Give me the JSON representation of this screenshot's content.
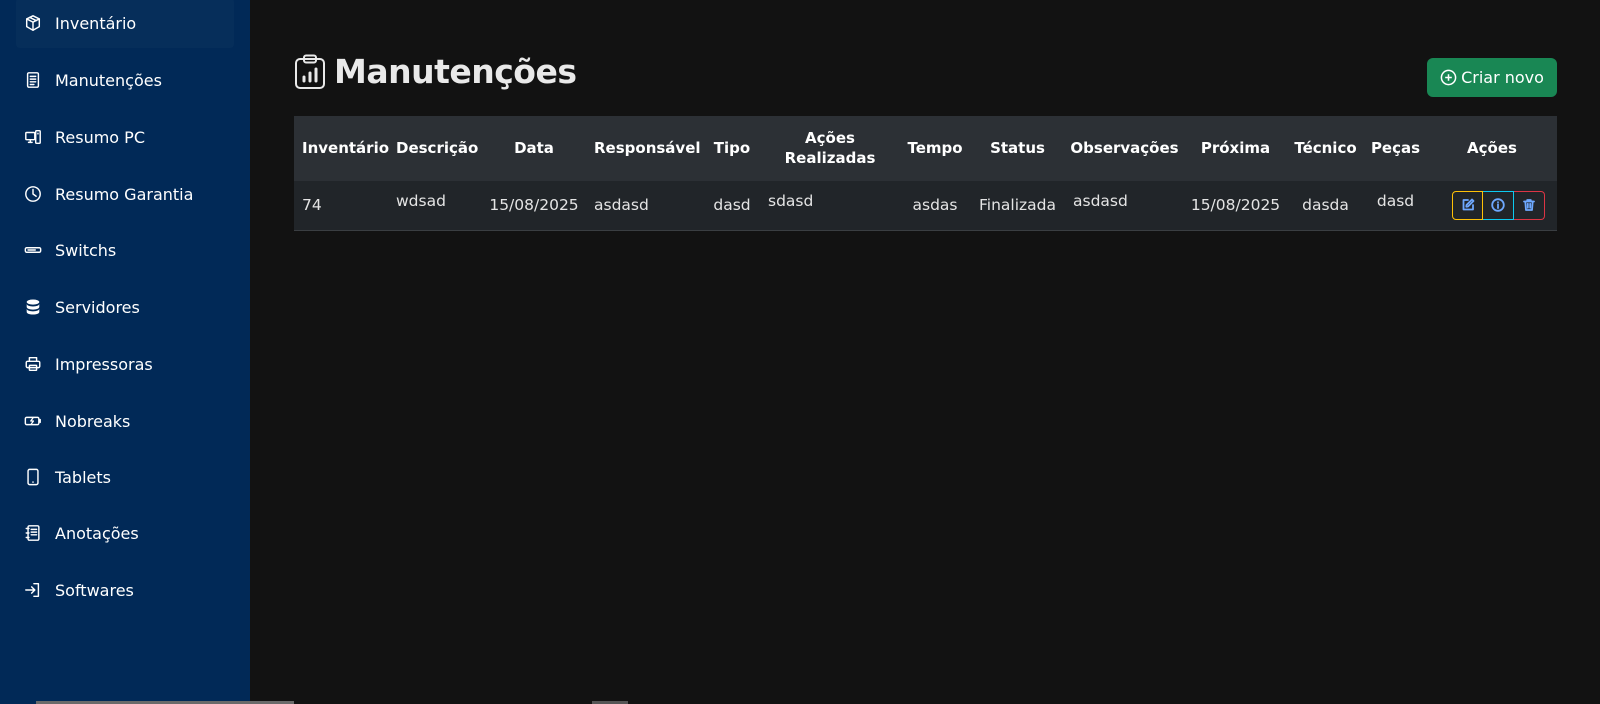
{
  "sidebar": {
    "items": [
      {
        "label": "Inventário",
        "icon": "box-icon",
        "active": true
      },
      {
        "label": "Manutenções",
        "icon": "document-icon"
      },
      {
        "label": "Resumo PC",
        "icon": "pc-icon"
      },
      {
        "label": "Resumo Garantia",
        "icon": "clock-icon"
      },
      {
        "label": "Switchs",
        "icon": "switch-icon"
      },
      {
        "label": "Servidores",
        "icon": "database-icon"
      },
      {
        "label": "Impressoras",
        "icon": "printer-icon"
      },
      {
        "label": "Nobreaks",
        "icon": "battery-icon"
      },
      {
        "label": "Tablets",
        "icon": "tablet-icon"
      },
      {
        "label": "Anotações",
        "icon": "notes-icon"
      },
      {
        "label": "Softwares",
        "icon": "login-icon"
      }
    ]
  },
  "page": {
    "title": "Manutenções",
    "create_button": "Criar novo"
  },
  "table": {
    "headers": {
      "inventario": "Inventário",
      "descricao": "Descrição",
      "data": "Data",
      "responsavel": "Responsável",
      "tipo": "Tipo",
      "acoes_realizadas_1": "Ações",
      "acoes_realizadas_2": "Realizadas",
      "tempo": "Tempo",
      "status": "Status",
      "observacoes": "Observações",
      "proxima": "Próxima",
      "tecnico": "Técnico",
      "pecas": "Peças",
      "acoes": "Ações"
    },
    "rows": [
      {
        "inventario": "74",
        "descricao": "wdsad",
        "data": "15/08/2025",
        "responsavel": "asdasd",
        "tipo": "dasd",
        "acoes_realizadas": "sdasd",
        "tempo": "asdas",
        "status": "Finalizada",
        "observacoes": "asdasd",
        "proxima": "15/08/2025",
        "tecnico": "dasda",
        "pecas": "dasd"
      }
    ]
  },
  "colors": {
    "sidebar": "#012957",
    "background": "#121212",
    "create_button": "#198754",
    "table_header": "#2c3035",
    "table_row": "#212529"
  }
}
